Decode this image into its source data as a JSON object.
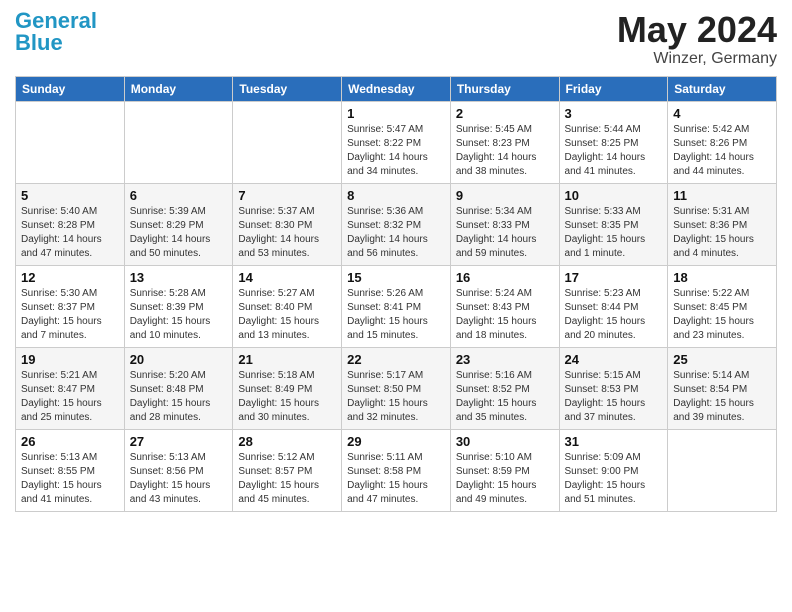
{
  "logo": {
    "line1": "General",
    "line2": "Blue",
    "tagline": ""
  },
  "title": {
    "month_year": "May 2024",
    "location": "Winzer, Germany"
  },
  "days_of_week": [
    "Sunday",
    "Monday",
    "Tuesday",
    "Wednesday",
    "Thursday",
    "Friday",
    "Saturday"
  ],
  "weeks": [
    [
      {
        "day": "",
        "info": ""
      },
      {
        "day": "",
        "info": ""
      },
      {
        "day": "",
        "info": ""
      },
      {
        "day": "1",
        "info": "Sunrise: 5:47 AM\nSunset: 8:22 PM\nDaylight: 14 hours\nand 34 minutes."
      },
      {
        "day": "2",
        "info": "Sunrise: 5:45 AM\nSunset: 8:23 PM\nDaylight: 14 hours\nand 38 minutes."
      },
      {
        "day": "3",
        "info": "Sunrise: 5:44 AM\nSunset: 8:25 PM\nDaylight: 14 hours\nand 41 minutes."
      },
      {
        "day": "4",
        "info": "Sunrise: 5:42 AM\nSunset: 8:26 PM\nDaylight: 14 hours\nand 44 minutes."
      }
    ],
    [
      {
        "day": "5",
        "info": "Sunrise: 5:40 AM\nSunset: 8:28 PM\nDaylight: 14 hours\nand 47 minutes."
      },
      {
        "day": "6",
        "info": "Sunrise: 5:39 AM\nSunset: 8:29 PM\nDaylight: 14 hours\nand 50 minutes."
      },
      {
        "day": "7",
        "info": "Sunrise: 5:37 AM\nSunset: 8:30 PM\nDaylight: 14 hours\nand 53 minutes."
      },
      {
        "day": "8",
        "info": "Sunrise: 5:36 AM\nSunset: 8:32 PM\nDaylight: 14 hours\nand 56 minutes."
      },
      {
        "day": "9",
        "info": "Sunrise: 5:34 AM\nSunset: 8:33 PM\nDaylight: 14 hours\nand 59 minutes."
      },
      {
        "day": "10",
        "info": "Sunrise: 5:33 AM\nSunset: 8:35 PM\nDaylight: 15 hours\nand 1 minute."
      },
      {
        "day": "11",
        "info": "Sunrise: 5:31 AM\nSunset: 8:36 PM\nDaylight: 15 hours\nand 4 minutes."
      }
    ],
    [
      {
        "day": "12",
        "info": "Sunrise: 5:30 AM\nSunset: 8:37 PM\nDaylight: 15 hours\nand 7 minutes."
      },
      {
        "day": "13",
        "info": "Sunrise: 5:28 AM\nSunset: 8:39 PM\nDaylight: 15 hours\nand 10 minutes."
      },
      {
        "day": "14",
        "info": "Sunrise: 5:27 AM\nSunset: 8:40 PM\nDaylight: 15 hours\nand 13 minutes."
      },
      {
        "day": "15",
        "info": "Sunrise: 5:26 AM\nSunset: 8:41 PM\nDaylight: 15 hours\nand 15 minutes."
      },
      {
        "day": "16",
        "info": "Sunrise: 5:24 AM\nSunset: 8:43 PM\nDaylight: 15 hours\nand 18 minutes."
      },
      {
        "day": "17",
        "info": "Sunrise: 5:23 AM\nSunset: 8:44 PM\nDaylight: 15 hours\nand 20 minutes."
      },
      {
        "day": "18",
        "info": "Sunrise: 5:22 AM\nSunset: 8:45 PM\nDaylight: 15 hours\nand 23 minutes."
      }
    ],
    [
      {
        "day": "19",
        "info": "Sunrise: 5:21 AM\nSunset: 8:47 PM\nDaylight: 15 hours\nand 25 minutes."
      },
      {
        "day": "20",
        "info": "Sunrise: 5:20 AM\nSunset: 8:48 PM\nDaylight: 15 hours\nand 28 minutes."
      },
      {
        "day": "21",
        "info": "Sunrise: 5:18 AM\nSunset: 8:49 PM\nDaylight: 15 hours\nand 30 minutes."
      },
      {
        "day": "22",
        "info": "Sunrise: 5:17 AM\nSunset: 8:50 PM\nDaylight: 15 hours\nand 32 minutes."
      },
      {
        "day": "23",
        "info": "Sunrise: 5:16 AM\nSunset: 8:52 PM\nDaylight: 15 hours\nand 35 minutes."
      },
      {
        "day": "24",
        "info": "Sunrise: 5:15 AM\nSunset: 8:53 PM\nDaylight: 15 hours\nand 37 minutes."
      },
      {
        "day": "25",
        "info": "Sunrise: 5:14 AM\nSunset: 8:54 PM\nDaylight: 15 hours\nand 39 minutes."
      }
    ],
    [
      {
        "day": "26",
        "info": "Sunrise: 5:13 AM\nSunset: 8:55 PM\nDaylight: 15 hours\nand 41 minutes."
      },
      {
        "day": "27",
        "info": "Sunrise: 5:13 AM\nSunset: 8:56 PM\nDaylight: 15 hours\nand 43 minutes."
      },
      {
        "day": "28",
        "info": "Sunrise: 5:12 AM\nSunset: 8:57 PM\nDaylight: 15 hours\nand 45 minutes."
      },
      {
        "day": "29",
        "info": "Sunrise: 5:11 AM\nSunset: 8:58 PM\nDaylight: 15 hours\nand 47 minutes."
      },
      {
        "day": "30",
        "info": "Sunrise: 5:10 AM\nSunset: 8:59 PM\nDaylight: 15 hours\nand 49 minutes."
      },
      {
        "day": "31",
        "info": "Sunrise: 5:09 AM\nSunset: 9:00 PM\nDaylight: 15 hours\nand 51 minutes."
      },
      {
        "day": "",
        "info": ""
      }
    ]
  ]
}
